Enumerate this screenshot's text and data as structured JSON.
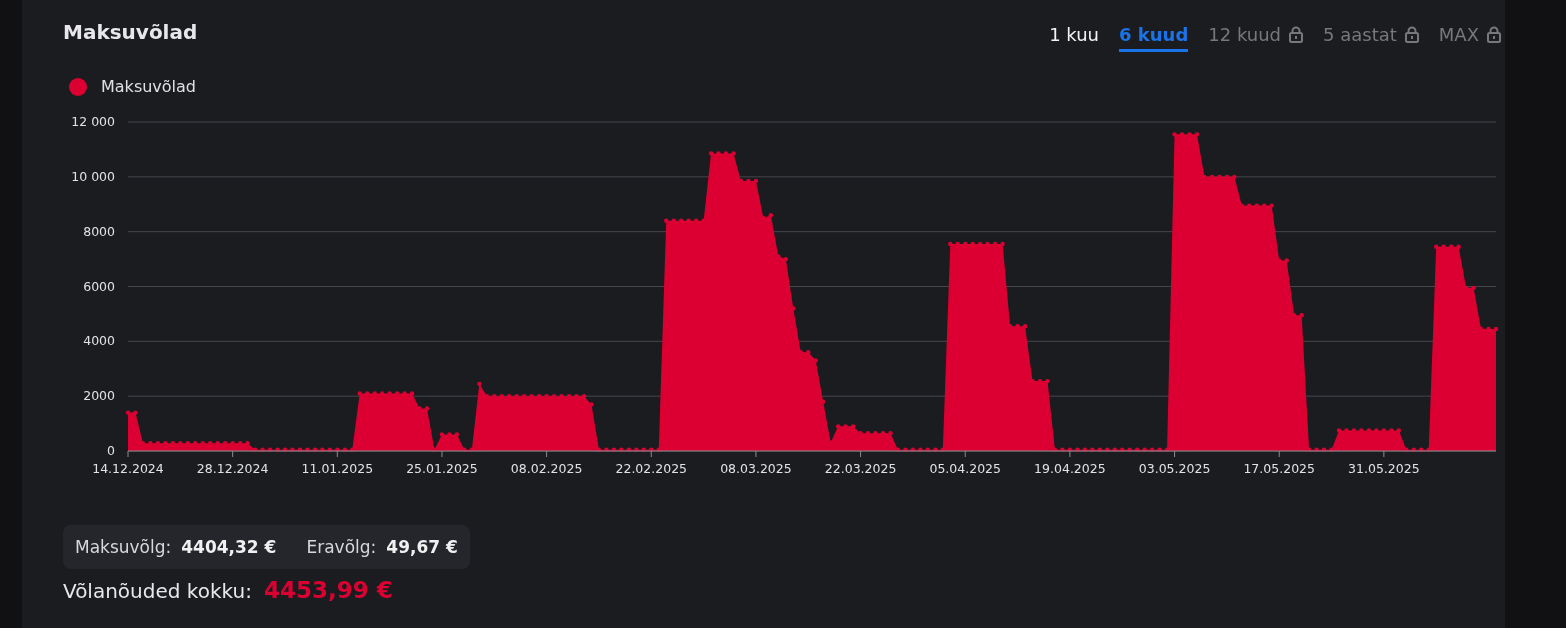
{
  "title": "Maksuvõlad",
  "tabs": [
    {
      "label": "1 kuu",
      "selected": false,
      "locked": false
    },
    {
      "label": "6 kuud",
      "selected": true,
      "locked": false
    },
    {
      "label": "12 kuud",
      "selected": false,
      "locked": true
    },
    {
      "label": "5 aastat",
      "selected": false,
      "locked": true
    },
    {
      "label": "MAX",
      "selected": false,
      "locked": true
    }
  ],
  "chart": {
    "chart_data": {
      "type": "area",
      "grid": true,
      "ylim": [
        0,
        12000
      ],
      "yticks": [
        {
          "value": 0,
          "label": "0"
        },
        {
          "value": 2000,
          "label": "2000"
        },
        {
          "value": 4000,
          "label": "4000"
        },
        {
          "value": 6000,
          "label": "6000"
        },
        {
          "value": 8000,
          "label": "8000"
        },
        {
          "value": 10000,
          "label": "10 000"
        },
        {
          "value": 12000,
          "label": "12 000"
        }
      ],
      "categories": [
        "14.12.2024",
        null,
        null,
        null,
        null,
        null,
        null,
        null,
        null,
        null,
        null,
        null,
        null,
        null,
        "28.12.2024",
        null,
        null,
        null,
        null,
        null,
        null,
        null,
        null,
        null,
        null,
        null,
        null,
        null,
        "11.01.2025",
        null,
        null,
        null,
        null,
        null,
        null,
        null,
        null,
        null,
        null,
        null,
        null,
        null,
        "25.01.2025",
        null,
        null,
        null,
        null,
        null,
        null,
        null,
        null,
        null,
        null,
        null,
        null,
        null,
        "08.02.2025",
        null,
        null,
        null,
        null,
        null,
        null,
        null,
        null,
        null,
        null,
        null,
        null,
        null,
        "22.02.2025",
        null,
        null,
        null,
        null,
        null,
        null,
        null,
        null,
        null,
        null,
        null,
        null,
        null,
        "08.03.2025",
        null,
        null,
        null,
        null,
        null,
        null,
        null,
        null,
        null,
        null,
        null,
        null,
        null,
        "22.03.2025",
        null,
        null,
        null,
        null,
        null,
        null,
        null,
        null,
        null,
        null,
        null,
        null,
        null,
        "05.04.2025",
        null,
        null,
        null,
        null,
        null,
        null,
        null,
        null,
        null,
        null,
        null,
        null,
        null,
        "19.04.2025",
        null,
        null,
        null,
        null,
        null,
        null,
        null,
        null,
        null,
        null,
        null,
        null,
        null,
        "03.05.2025",
        null,
        null,
        null,
        null,
        null,
        null,
        null,
        null,
        null,
        null,
        null,
        null,
        null,
        "17.05.2025",
        null,
        null,
        null,
        null,
        null,
        null,
        null,
        null,
        null,
        null,
        null,
        null,
        null,
        "31.05.2025",
        null,
        null,
        null,
        null,
        null,
        null,
        null,
        null,
        null,
        null,
        null,
        null,
        null,
        null,
        null
      ],
      "series": [
        {
          "name": "Maksuvõlad",
          "color": "#dc0032",
          "values": [
            1400,
            1400,
            280,
            280,
            280,
            280,
            280,
            280,
            280,
            280,
            280,
            280,
            280,
            280,
            280,
            280,
            280,
            50,
            50,
            50,
            50,
            50,
            50,
            50,
            50,
            50,
            50,
            50,
            50,
            50,
            50,
            2100,
            2100,
            2100,
            2100,
            2100,
            2100,
            2100,
            2100,
            1550,
            1550,
            50,
            600,
            600,
            600,
            50,
            50,
            2450,
            2000,
            2000,
            2000,
            2000,
            2000,
            2000,
            2000,
            2000,
            2000,
            2000,
            2000,
            2000,
            2000,
            2000,
            1700,
            50,
            50,
            50,
            50,
            50,
            50,
            50,
            50,
            50,
            8400,
            8400,
            8400,
            8400,
            8400,
            8400,
            10850,
            10850,
            10850,
            10850,
            9850,
            9850,
            9850,
            8500,
            8600,
            7100,
            7000,
            5200,
            3600,
            3600,
            3300,
            1800,
            300,
            900,
            900,
            900,
            650,
            650,
            650,
            650,
            650,
            50,
            50,
            50,
            50,
            50,
            50,
            50,
            7550,
            7550,
            7550,
            7550,
            7550,
            7550,
            7550,
            7550,
            4550,
            4550,
            4550,
            2550,
            2550,
            2550,
            50,
            50,
            50,
            50,
            50,
            50,
            50,
            50,
            50,
            50,
            50,
            50,
            50,
            50,
            50,
            50,
            11550,
            11550,
            11550,
            11550,
            10000,
            10000,
            10000,
            10000,
            10000,
            8950,
            8950,
            8950,
            8950,
            8950,
            6950,
            6950,
            4950,
            4950,
            50,
            50,
            50,
            50,
            750,
            750,
            750,
            750,
            750,
            750,
            750,
            750,
            750,
            50,
            50,
            50,
            50,
            7450,
            7450,
            7450,
            7450,
            5950,
            5950,
            4450,
            4450,
            4450
          ]
        }
      ]
    }
  },
  "summary": {
    "items": [
      {
        "label": "Maksuvõlg:",
        "value": "4404,32 €"
      },
      {
        "label": "Eravõlg:",
        "value": "49,67 €"
      }
    ],
    "total_label": "Võlanõuded kokku:",
    "total_value": "4453,99 €"
  }
}
